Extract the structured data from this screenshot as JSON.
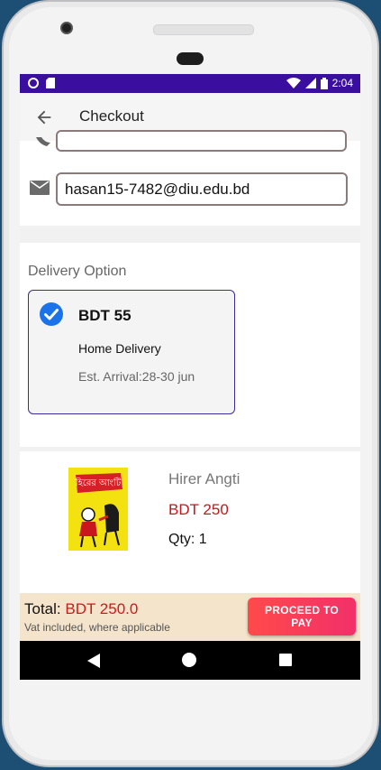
{
  "status": {
    "time": "2:04"
  },
  "appbar": {
    "title": "Checkout"
  },
  "contact": {
    "email_value": "hasan15-7482@diu.edu.bd"
  },
  "delivery": {
    "section_title": "Delivery Option",
    "option": {
      "price": "BDT 55",
      "method": "Home Delivery",
      "eta": "Est. Arrival:28-30 jun",
      "selected": true
    }
  },
  "cart": {
    "items": [
      {
        "title": "Hirer Angti",
        "price": "BDT 250",
        "qty": "Qty: 1",
        "cover_text": "হিরের আংটি"
      }
    ]
  },
  "footer": {
    "total_label": "Total:",
    "total_amount": "BDT 250.0",
    "vat_note": "Vat included, where applicable",
    "pay_button": "PROCEED TO PAY"
  },
  "colors": {
    "accent": "#3a0f9f",
    "price_red": "#c4161c",
    "pay_button": "#f2306a",
    "check_blue": "#1a73e8"
  },
  "icons": [
    "back-arrow-icon",
    "mail-icon",
    "check-circle-icon",
    "nav-back-icon",
    "nav-home-icon",
    "nav-recent-icon"
  ]
}
